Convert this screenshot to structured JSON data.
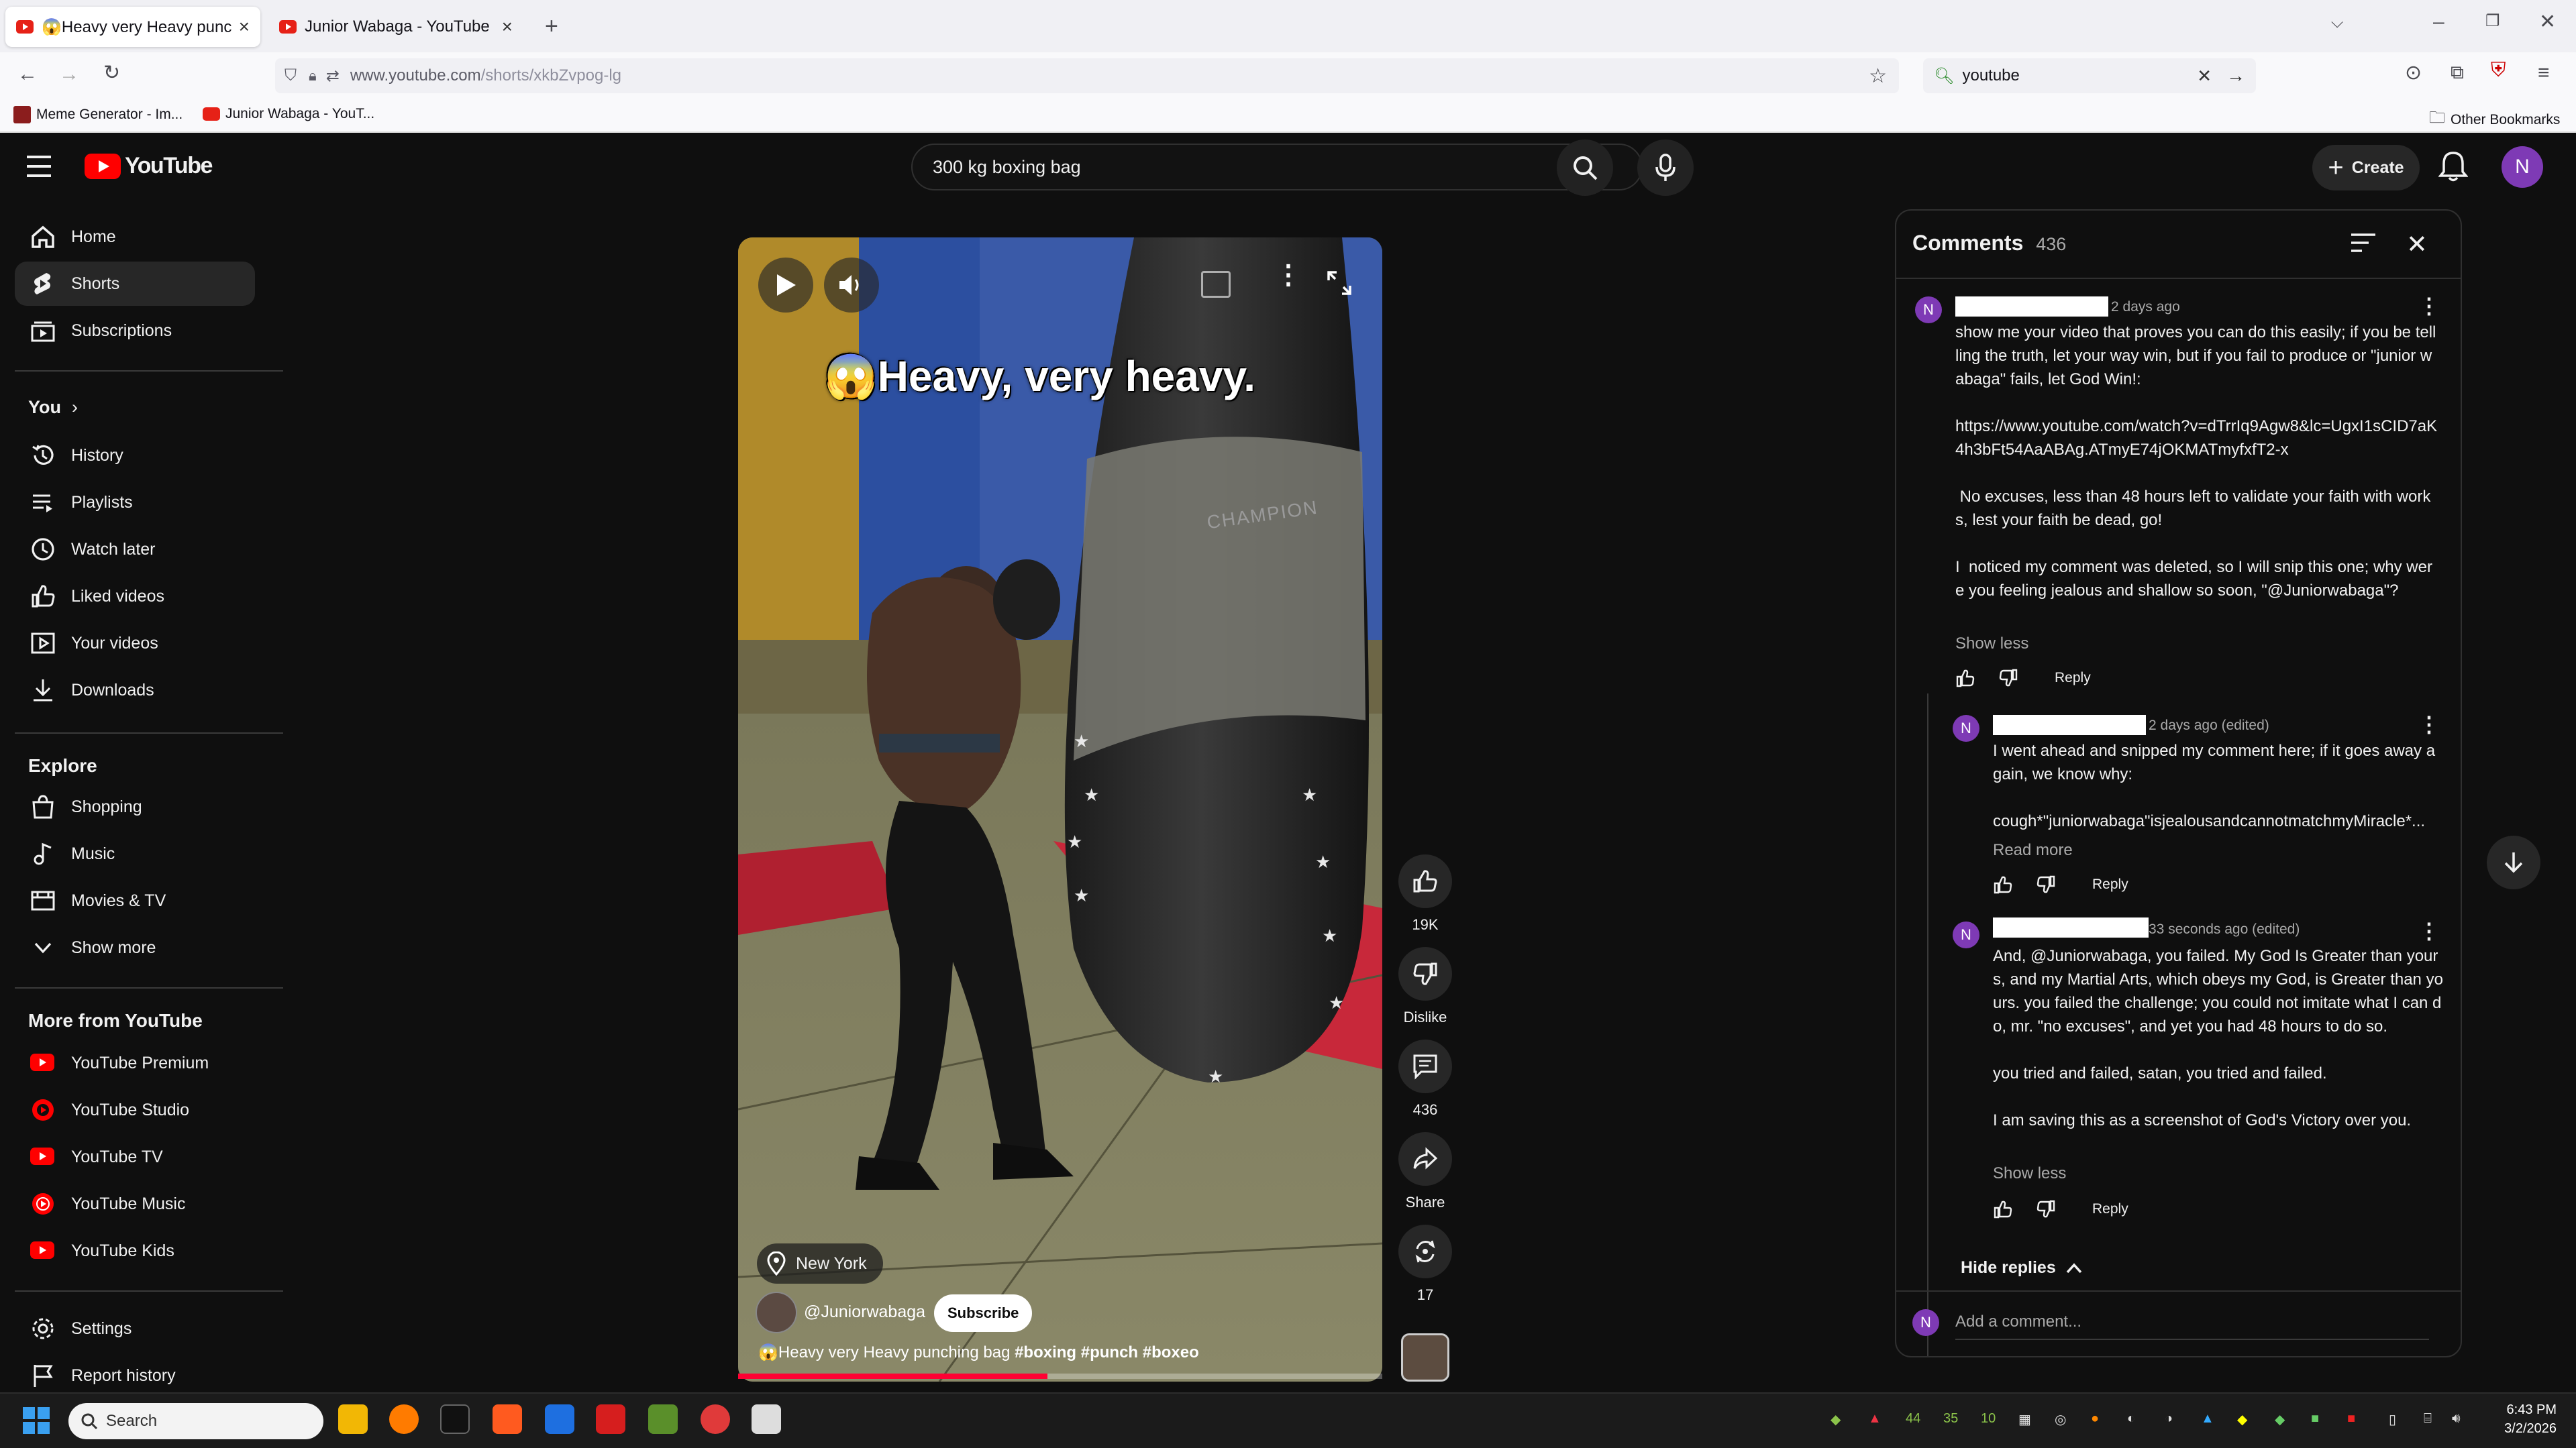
{
  "browser": {
    "tabs": [
      {
        "title": "😱Heavy very Heavy punching",
        "active": true
      },
      {
        "title": "Junior Wabaga - YouTube",
        "active": false
      }
    ],
    "url_prefix": "www.youtube.com",
    "url_path": "/shorts/xkbZvpog-lg",
    "search_box_value": "youtube",
    "bookmarks": [
      "Meme Generator - Im...",
      "Junior Wabaga - YouT..."
    ],
    "other_bookmarks": "Other Bookmarks"
  },
  "youtube": {
    "logo_text": "YouTube",
    "search_query": "300 kg boxing bag",
    "create_label": "Create",
    "avatar_letter": "N",
    "sidebar": {
      "main": [
        {
          "label": "Home",
          "icon": "home-icon"
        },
        {
          "label": "Shorts",
          "icon": "shorts-icon",
          "active": true
        },
        {
          "label": "Subscriptions",
          "icon": "subscriptions-icon"
        }
      ],
      "you_heading": "You",
      "you": [
        {
          "label": "History",
          "icon": "history-icon"
        },
        {
          "label": "Playlists",
          "icon": "playlists-icon"
        },
        {
          "label": "Watch later",
          "icon": "watch-later-icon"
        },
        {
          "label": "Liked videos",
          "icon": "like-icon"
        },
        {
          "label": "Your videos",
          "icon": "your-videos-icon"
        },
        {
          "label": "Downloads",
          "icon": "download-icon"
        }
      ],
      "explore_heading": "Explore",
      "explore": [
        {
          "label": "Shopping",
          "icon": "shopping-icon"
        },
        {
          "label": "Music",
          "icon": "music-icon"
        },
        {
          "label": "Movies & TV",
          "icon": "movies-icon"
        },
        {
          "label": "Show more",
          "icon": "chevron-down-icon"
        }
      ],
      "more_heading": "More from YouTube",
      "more": [
        {
          "label": "YouTube Premium"
        },
        {
          "label": "YouTube Studio"
        },
        {
          "label": "YouTube TV"
        },
        {
          "label": "YouTube Music"
        },
        {
          "label": "YouTube Kids"
        }
      ],
      "bottom": [
        {
          "label": "Settings",
          "icon": "gear-icon"
        },
        {
          "label": "Report history",
          "icon": "flag-icon"
        }
      ]
    },
    "short": {
      "overlay_text": "😱Heavy, very heavy.",
      "location": "New York",
      "channel": "@Juniorwabaga",
      "subscribe_label": "Subscribe",
      "caption_plain": "😱Heavy very Heavy punching bag ",
      "caption_tags": "#boxing #punch #boxeo",
      "bag_brand": "CHAMPION",
      "progress": 0.48
    },
    "actions": {
      "likes": "19K",
      "dislike_label": "Dislike",
      "comments": "436",
      "share_label": "Share",
      "remix": "17"
    },
    "comments_panel": {
      "title": "Comments",
      "count": "436",
      "add_placeholder": "Add a comment...",
      "reply_label": "Reply",
      "hide_replies_label": "Hide replies",
      "items": [
        {
          "avatar": "N",
          "time": "2 days ago",
          "text": "show me your video that proves you can do this easily; if you be tellling the truth, let your way win, but if you fail to produce or \"junior wabaga\" fails, let God Win!:\n\nhttps://www.youtube.com/watch?v=dTrrIq9Agw8&lc=UgxI1sCID7aK4h3bFt54AaABAg.ATmyE74jOKMATmyfxfT2-x\n\n No excuses, less than 48 hours left to validate your faith with works, lest your faith be dead, go!\n\nI  noticed my comment was deleted, so I will snip this one; why were you feeling jealous and shallow so soon, \"@Juniorwabaga\"?",
          "toggle": "Show less"
        },
        {
          "avatar": "N",
          "time": "2 days ago (edited)",
          "text": "I went ahead and snipped my comment here; if it goes away again, we know why:\n\ncough*\"juniorwabaga\"isjealousandcannotmatchmyMiracle*...",
          "toggle": "Read more"
        },
        {
          "avatar": "N",
          "time": "33 seconds ago (edited)",
          "text": "And, @Juniorwabaga, you failed. My God Is Greater than yours, and my Martial Arts, which obeys my God, is Greater than yours. you failed the challenge; you could not imitate what I can do, mr. \"no excuses\", and yet you had 48 hours to do so.\n\nyou tried and failed, satan, you tried and failed.\n\nI am saving this as a screenshot of God's Victory over you.",
          "toggle": "Show less"
        }
      ]
    }
  },
  "taskbar": {
    "search_placeholder": "Search",
    "time": "6:43 PM",
    "date": "3/2/2026",
    "tray_numbers": [
      "44",
      "35",
      "10"
    ]
  },
  "colors": {
    "yt_red": "#ff0000",
    "bg": "#0f0f0f",
    "avatar_purple": "#7e3ab5",
    "progress_red": "#ff0033"
  }
}
